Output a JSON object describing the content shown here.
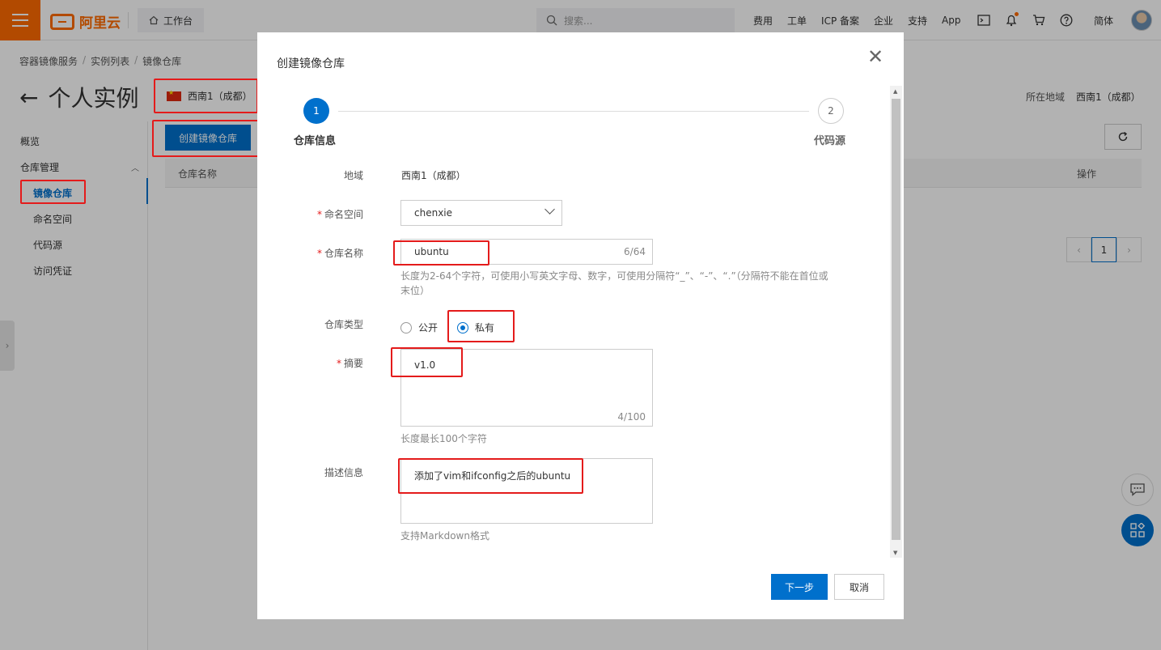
{
  "topbar": {
    "brand": "阿里云",
    "workbench": "工作台",
    "search_placeholder": "搜索...",
    "links": [
      "费用",
      "工单",
      "ICP 备案",
      "企业",
      "支持",
      "App"
    ],
    "lang": "简体"
  },
  "page": {
    "breadcrumb": [
      "容器镜像服务",
      "实例列表",
      "镜像仓库"
    ],
    "title": "个人实例",
    "region": "西南1（成都）",
    "region_label": "所在地域",
    "region_value": "西南1（成都）",
    "create_button": "创建镜像仓库",
    "table_headers": [
      "仓库名称",
      "操作"
    ],
    "current_page": "1"
  },
  "sidebar": {
    "overview": "概览",
    "repo_mgmt": "仓库管理",
    "items": [
      "镜像仓库",
      "命名空间",
      "代码源",
      "访问凭证"
    ]
  },
  "dialog": {
    "title": "创建镜像仓库",
    "steps": [
      {
        "num": "1",
        "label": "仓库信息"
      },
      {
        "num": "2",
        "label": "代码源"
      }
    ],
    "fields": {
      "region_label": "地域",
      "region_value": "西南1（成都）",
      "namespace_label": "命名空间",
      "namespace_value": "chenxie",
      "repo_name_label": "仓库名称",
      "repo_name_value": "ubuntu",
      "repo_name_count": "6/64",
      "repo_name_hint": "长度为2-64个字符，可使用小写英文字母、数字，可使用分隔符“_”、“-”、“.”（分隔符不能在首位或末位）",
      "repo_type_label": "仓库类型",
      "repo_type_public": "公开",
      "repo_type_private": "私有",
      "summary_label": "摘要",
      "summary_value": "v1.0",
      "summary_count": "4/100",
      "summary_hint": "长度最长100个字符",
      "desc_label": "描述信息",
      "desc_value": "添加了vim和ifconfig之后的ubuntu",
      "desc_hint": "支持Markdown格式"
    },
    "next_button": "下一步",
    "cancel_button": "取消"
  }
}
